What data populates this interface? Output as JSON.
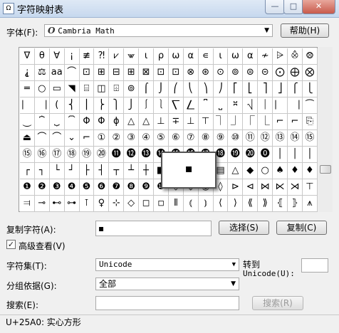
{
  "window": {
    "title": "字符映射表",
    "icon": "charmap-app-icon"
  },
  "font": {
    "label": "字体(F):",
    "value": "Cambria Math",
    "icon_glyph": "O"
  },
  "help_button": "帮助(H)",
  "grid": {
    "rows": [
      [
        "∇",
        "θ",
        "∀",
        "¡",
        "≢",
        "⁈",
        "⩗",
        "⩖",
        "ι",
        "ρ",
        "ω",
        "α",
        "∊",
        "ι",
        "ω",
        "α",
        "≁",
        "⩥",
        "⨶",
        "⨷"
      ],
      [
        "⸘",
        "⚖",
        "aa",
        "⌒",
        "⊡",
        "⊞",
        "⊟",
        "⊞",
        "⊠",
        "⊡",
        "⊡",
        "⊗",
        "⊛",
        "⊙",
        "⊚",
        "⊜",
        "⊝",
        "⨀",
        "⨁",
        "⨂"
      ],
      [
        "═",
        "○",
        "▭",
        "◥",
        "⌸",
        "◫",
        "⌹",
        "⊚",
        "⌠",
        "⌡",
        "⎛",
        "⎝",
        "⎞",
        "⎠",
        "⎡",
        "⎣",
        "⎤",
        "⎦",
        "⎧",
        "⎩"
      ],
      [
        "⎸",
        "⎹",
        "(",
        "⎨",
        "⎪",
        "⎬",
        "⎫",
        "⎭",
        "⎰",
        "⎱",
        "⎲",
        "⎳",
        "⎴",
        "⎵",
        "⎶",
        "⎷",
        "⏐",
        "⎸",
        "⎹",
        "⏜"
      ],
      [
        "⏝",
        "⏞",
        "⏟",
        "⏠",
        "Φ",
        "Φ",
        "ϕ",
        "△",
        "△",
        "⊥",
        "∓",
        "⊥",
        "⊤",
        "⏋",
        "⏌",
        "⎾",
        "⎿",
        "⌐",
        "⌐",
        "⎘"
      ],
      [
        "⏏",
        "⌒",
        "⌒",
        "⌄",
        "⌐",
        "①",
        "②",
        "③",
        "④",
        "⑤",
        "⑥",
        "⑦",
        "⑧",
        "⑨",
        "⑩",
        "⑪",
        "⑫",
        "⑬",
        "⑭",
        "⑮"
      ],
      [
        "⑮",
        "⑯",
        "⑰",
        "⑱",
        "⑲",
        "⑳",
        "⓫",
        "⓬",
        "⓭",
        "⓮",
        "⓯",
        "⓰",
        "⓱",
        "⓲",
        "⓳",
        "⓴",
        "⓿",
        "│",
        "│",
        "│"
      ],
      [
        "┌",
        "┐",
        "└",
        "┘",
        "├",
        "┤",
        "┬",
        "┴",
        "┼",
        "■",
        "□",
        "▢",
        "▣",
        "▤",
        "△",
        "◆",
        "○",
        "♠",
        "♦",
        "♦"
      ],
      [
        "❶",
        "❷",
        "❸",
        "❹",
        "❺",
        "❻",
        "❼",
        "❽",
        "❾",
        "❿",
        "◇",
        "◈",
        "◉",
        "◊",
        "⊳",
        "⊲",
        "⋈",
        "⋉",
        "⋊",
        "⊤"
      ],
      [
        "⫤",
        "⊸",
        "⊷",
        "⊶",
        "⊺",
        "♀",
        "⊹",
        "◇",
        "◻",
        "◽",
        "⦀",
        "⦅",
        "⦆",
        "⟨",
        "⟩",
        "⟪",
        "⟫",
        "⦃",
        "⦄",
        "⩚"
      ]
    ]
  },
  "zoom_char": "▪",
  "copy": {
    "label": "复制字符(A):",
    "value": "▪",
    "select_button": "选择(S)",
    "copy_button": "复制(C)"
  },
  "advanced": {
    "label": "高级查看(V)",
    "checked": true,
    "check_glyph": "✓"
  },
  "charset": {
    "label": "字符集(T):",
    "value": "Unicode"
  },
  "goto_unicode": {
    "label_line1": "转到",
    "label_line2": "Unicode(U):",
    "value": ""
  },
  "group_by": {
    "label": "分组依据(G):",
    "value": "全部"
  },
  "search": {
    "label": "搜索(E):",
    "value": "",
    "button": "搜索(R)"
  },
  "status": "U+25A0: 实心方形"
}
